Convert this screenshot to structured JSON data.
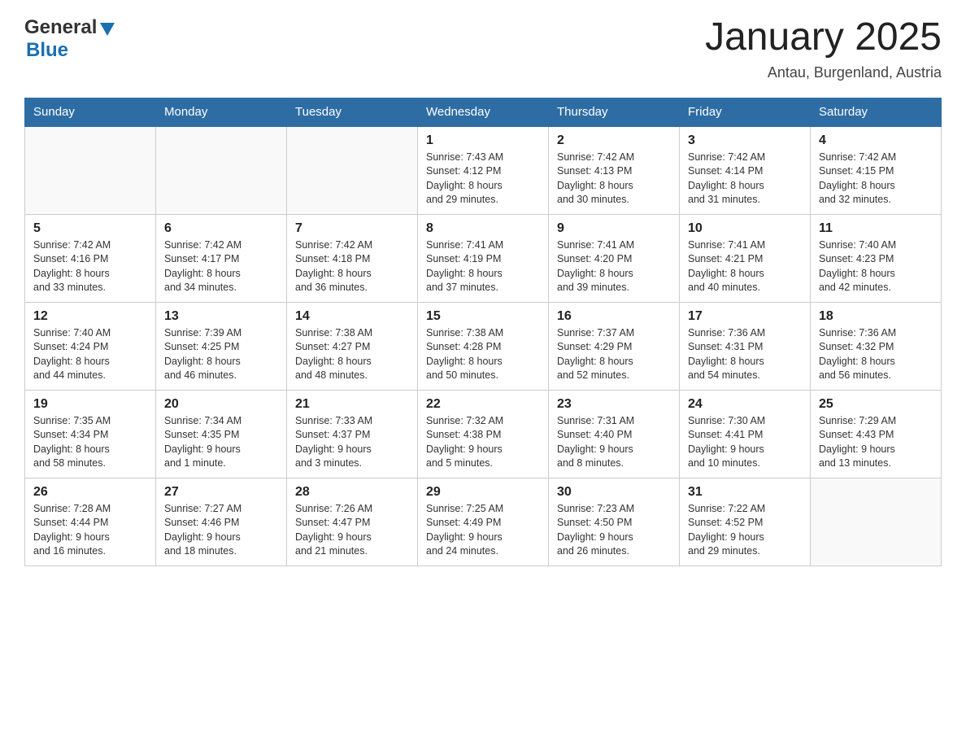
{
  "header": {
    "logo": {
      "general": "General",
      "blue": "Blue"
    },
    "title": "January 2025",
    "subtitle": "Antau, Burgenland, Austria"
  },
  "days_of_week": [
    "Sunday",
    "Monday",
    "Tuesday",
    "Wednesday",
    "Thursday",
    "Friday",
    "Saturday"
  ],
  "weeks": [
    [
      {
        "day": "",
        "info": ""
      },
      {
        "day": "",
        "info": ""
      },
      {
        "day": "",
        "info": ""
      },
      {
        "day": "1",
        "info": "Sunrise: 7:43 AM\nSunset: 4:12 PM\nDaylight: 8 hours\nand 29 minutes."
      },
      {
        "day": "2",
        "info": "Sunrise: 7:42 AM\nSunset: 4:13 PM\nDaylight: 8 hours\nand 30 minutes."
      },
      {
        "day": "3",
        "info": "Sunrise: 7:42 AM\nSunset: 4:14 PM\nDaylight: 8 hours\nand 31 minutes."
      },
      {
        "day": "4",
        "info": "Sunrise: 7:42 AM\nSunset: 4:15 PM\nDaylight: 8 hours\nand 32 minutes."
      }
    ],
    [
      {
        "day": "5",
        "info": "Sunrise: 7:42 AM\nSunset: 4:16 PM\nDaylight: 8 hours\nand 33 minutes."
      },
      {
        "day": "6",
        "info": "Sunrise: 7:42 AM\nSunset: 4:17 PM\nDaylight: 8 hours\nand 34 minutes."
      },
      {
        "day": "7",
        "info": "Sunrise: 7:42 AM\nSunset: 4:18 PM\nDaylight: 8 hours\nand 36 minutes."
      },
      {
        "day": "8",
        "info": "Sunrise: 7:41 AM\nSunset: 4:19 PM\nDaylight: 8 hours\nand 37 minutes."
      },
      {
        "day": "9",
        "info": "Sunrise: 7:41 AM\nSunset: 4:20 PM\nDaylight: 8 hours\nand 39 minutes."
      },
      {
        "day": "10",
        "info": "Sunrise: 7:41 AM\nSunset: 4:21 PM\nDaylight: 8 hours\nand 40 minutes."
      },
      {
        "day": "11",
        "info": "Sunrise: 7:40 AM\nSunset: 4:23 PM\nDaylight: 8 hours\nand 42 minutes."
      }
    ],
    [
      {
        "day": "12",
        "info": "Sunrise: 7:40 AM\nSunset: 4:24 PM\nDaylight: 8 hours\nand 44 minutes."
      },
      {
        "day": "13",
        "info": "Sunrise: 7:39 AM\nSunset: 4:25 PM\nDaylight: 8 hours\nand 46 minutes."
      },
      {
        "day": "14",
        "info": "Sunrise: 7:38 AM\nSunset: 4:27 PM\nDaylight: 8 hours\nand 48 minutes."
      },
      {
        "day": "15",
        "info": "Sunrise: 7:38 AM\nSunset: 4:28 PM\nDaylight: 8 hours\nand 50 minutes."
      },
      {
        "day": "16",
        "info": "Sunrise: 7:37 AM\nSunset: 4:29 PM\nDaylight: 8 hours\nand 52 minutes."
      },
      {
        "day": "17",
        "info": "Sunrise: 7:36 AM\nSunset: 4:31 PM\nDaylight: 8 hours\nand 54 minutes."
      },
      {
        "day": "18",
        "info": "Sunrise: 7:36 AM\nSunset: 4:32 PM\nDaylight: 8 hours\nand 56 minutes."
      }
    ],
    [
      {
        "day": "19",
        "info": "Sunrise: 7:35 AM\nSunset: 4:34 PM\nDaylight: 8 hours\nand 58 minutes."
      },
      {
        "day": "20",
        "info": "Sunrise: 7:34 AM\nSunset: 4:35 PM\nDaylight: 9 hours\nand 1 minute."
      },
      {
        "day": "21",
        "info": "Sunrise: 7:33 AM\nSunset: 4:37 PM\nDaylight: 9 hours\nand 3 minutes."
      },
      {
        "day": "22",
        "info": "Sunrise: 7:32 AM\nSunset: 4:38 PM\nDaylight: 9 hours\nand 5 minutes."
      },
      {
        "day": "23",
        "info": "Sunrise: 7:31 AM\nSunset: 4:40 PM\nDaylight: 9 hours\nand 8 minutes."
      },
      {
        "day": "24",
        "info": "Sunrise: 7:30 AM\nSunset: 4:41 PM\nDaylight: 9 hours\nand 10 minutes."
      },
      {
        "day": "25",
        "info": "Sunrise: 7:29 AM\nSunset: 4:43 PM\nDaylight: 9 hours\nand 13 minutes."
      }
    ],
    [
      {
        "day": "26",
        "info": "Sunrise: 7:28 AM\nSunset: 4:44 PM\nDaylight: 9 hours\nand 16 minutes."
      },
      {
        "day": "27",
        "info": "Sunrise: 7:27 AM\nSunset: 4:46 PM\nDaylight: 9 hours\nand 18 minutes."
      },
      {
        "day": "28",
        "info": "Sunrise: 7:26 AM\nSunset: 4:47 PM\nDaylight: 9 hours\nand 21 minutes."
      },
      {
        "day": "29",
        "info": "Sunrise: 7:25 AM\nSunset: 4:49 PM\nDaylight: 9 hours\nand 24 minutes."
      },
      {
        "day": "30",
        "info": "Sunrise: 7:23 AM\nSunset: 4:50 PM\nDaylight: 9 hours\nand 26 minutes."
      },
      {
        "day": "31",
        "info": "Sunrise: 7:22 AM\nSunset: 4:52 PM\nDaylight: 9 hours\nand 29 minutes."
      },
      {
        "day": "",
        "info": ""
      }
    ]
  ]
}
